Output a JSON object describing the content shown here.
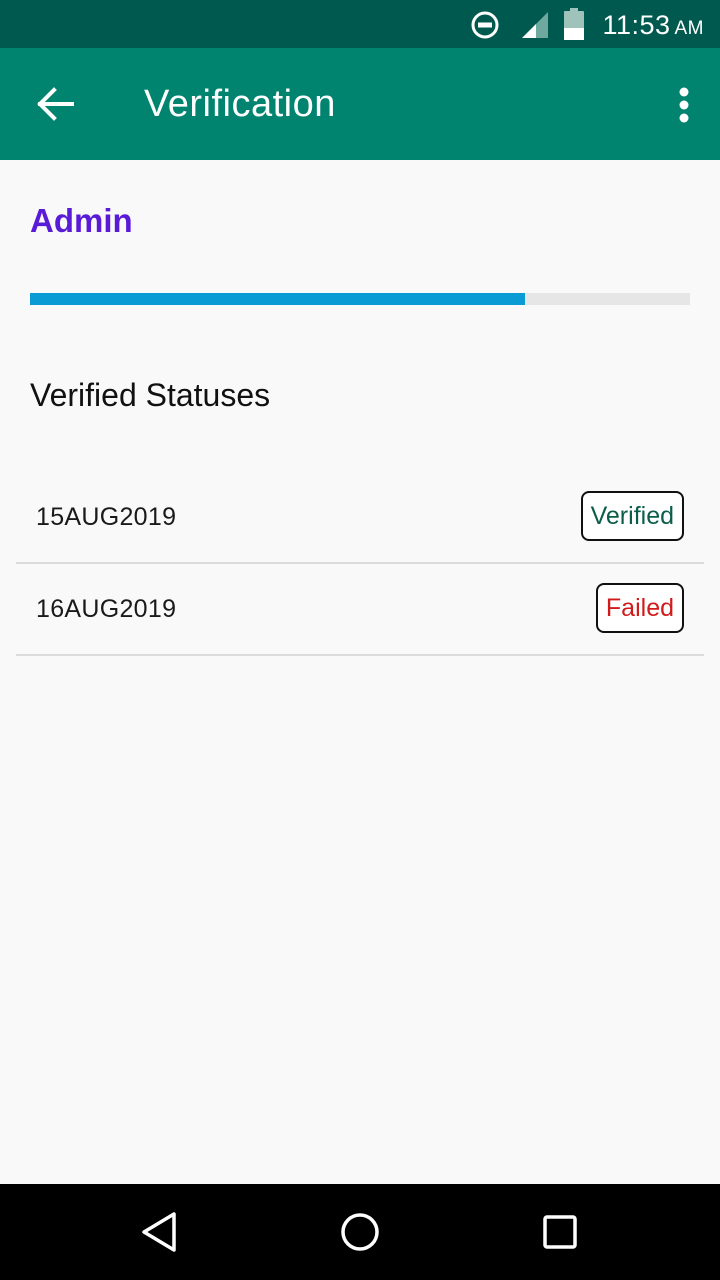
{
  "status_bar": {
    "time": "11:53",
    "ampm": "AM",
    "icons": [
      "do-not-disturb-icon",
      "signal-icon",
      "battery-icon"
    ]
  },
  "app_bar": {
    "title": "Verification",
    "back_icon": "arrow-back-icon",
    "menu_icon": "more-vert-icon"
  },
  "profile": {
    "name": "Admin",
    "progress": 0.75
  },
  "section": {
    "title": "Verified Statuses"
  },
  "statuses": [
    {
      "date": "15AUG2019",
      "status": "Verified",
      "color": "#0b5e49"
    },
    {
      "date": "16AUG2019",
      "status": "Failed",
      "color": "#d01b1b"
    }
  ],
  "colors": {
    "status_bar": "#00594e",
    "app_bar": "#00836f",
    "accent_name": "#5a1bd9",
    "progress_fill": "#0a9bd4",
    "progress_track": "#e6e6e6",
    "verified": "#0b5e49",
    "failed": "#d01b1b"
  },
  "nav_bar": {
    "icons": [
      "nav-back-icon",
      "nav-home-icon",
      "nav-recents-icon"
    ]
  }
}
